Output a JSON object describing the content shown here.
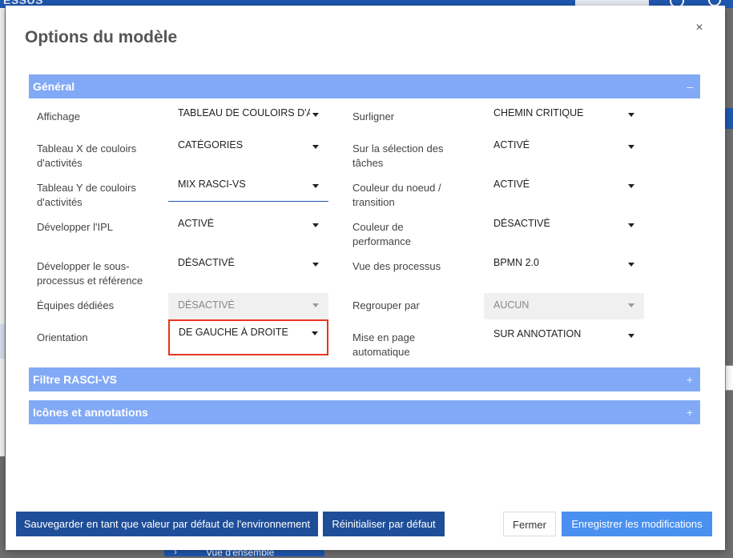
{
  "background": {
    "brand": "ESSUS",
    "bottom_item": "Vue d'ensemble"
  },
  "modal": {
    "title": "Options du modèle",
    "close_glyph": "×"
  },
  "sections": {
    "general": {
      "label": "Général",
      "toggle": "–",
      "expanded": true
    },
    "rasci": {
      "label": "Filtre RASCI-VS",
      "toggle": "+",
      "expanded": false
    },
    "icons": {
      "label": "Icônes et annotations",
      "toggle": "+",
      "expanded": false
    }
  },
  "fields": {
    "affichage": {
      "label": "Affichage",
      "value": "TABLEAU DE COULOIRS D'ACTIVITÉS"
    },
    "tableau_x": {
      "label": "Tableau X de couloirs d'activités",
      "value": "CATÉGORIES"
    },
    "tableau_y": {
      "label": "Tableau Y de couloirs d'activités",
      "value": "MIX RASCI-VS"
    },
    "developper_ipl": {
      "label": "Développer l'IPL",
      "value": "ACTIVÉ"
    },
    "developper_sous": {
      "label": "Développer le sous-processus et référence",
      "value": "DÉSACTIVÉ"
    },
    "equipes": {
      "label": "Équipes dédiées",
      "value": "DÉSACTIVÉ",
      "disabled": true
    },
    "orientation": {
      "label": "Orientation",
      "value": "DE GAUCHE À DROITE"
    },
    "surligner": {
      "label": "Surligner",
      "value": "CHEMIN CRITIQUE"
    },
    "selection_taches": {
      "label": "Sur la sélection des tâches",
      "value": "ACTIVÉ"
    },
    "couleur_noeud": {
      "label": "Couleur du noeud / transition",
      "value": "ACTIVÉ"
    },
    "couleur_perf": {
      "label": "Couleur de performance",
      "value": "DÉSACTIVÉ"
    },
    "vue_processus": {
      "label": "Vue des processus",
      "value": "BPMN 2.0"
    },
    "regrouper": {
      "label": "Regrouper par",
      "value": "AUCUN",
      "disabled": true
    },
    "mise_en_page": {
      "label": "Mise en page automatique",
      "value": "SUR ANNOTATION"
    }
  },
  "footer": {
    "save_default": "Sauvegarder en tant que valeur par défaut de l'environnement",
    "reset_default": "Réinitialiser par défaut",
    "close": "Fermer",
    "save": "Enregistrer les modifications"
  },
  "colors": {
    "section_header": "#82a9f6",
    "primary_dark": "#1f4e98",
    "primary": "#4a90f0",
    "highlight_border": "#e5361f"
  }
}
